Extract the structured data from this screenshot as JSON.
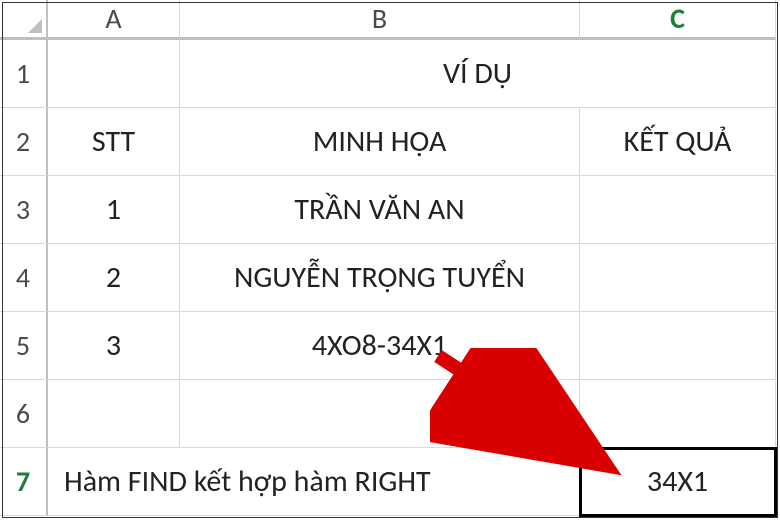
{
  "columns": {
    "A": "A",
    "B": "B",
    "C": "C"
  },
  "rows": {
    "r1": "1",
    "r2": "2",
    "r3": "3",
    "r4": "4",
    "r5": "5",
    "r6": "6",
    "r7": "7"
  },
  "cells": {
    "B1_merged": "VÍ DỤ",
    "A2": "STT",
    "B2": "MINH HỌA",
    "C2": "KẾT QUẢ",
    "A3": "1",
    "B3": "TRẦN VĂN AN",
    "A4": "2",
    "B4": "NGUYỄN TRỌNG TUYỂN",
    "A5": "3",
    "B5": "4XO8-34X1",
    "A7_merged": "Hàm FIND kết hợp hàm RIGHT",
    "C7": "34X1"
  },
  "active": {
    "col": "C",
    "row": "7"
  },
  "chart_data": {
    "type": "table",
    "columns": [
      "STT",
      "MINH HỌA",
      "KẾT QUẢ"
    ],
    "rows": [
      {
        "STT": "1",
        "MINH HỌA": "TRẦN VĂN AN",
        "KẾT QUẢ": ""
      },
      {
        "STT": "2",
        "MINH HỌA": "NGUYỄN TRỌNG TUYỂN",
        "KẾT QUẢ": ""
      },
      {
        "STT": "3",
        "MINH HỌA": "4XO8-34X1",
        "KẾT QUẢ": ""
      }
    ],
    "footer": {
      "label": "Hàm FIND kết hợp hàm RIGHT",
      "result": "34X1"
    },
    "title": "VÍ DỤ"
  }
}
